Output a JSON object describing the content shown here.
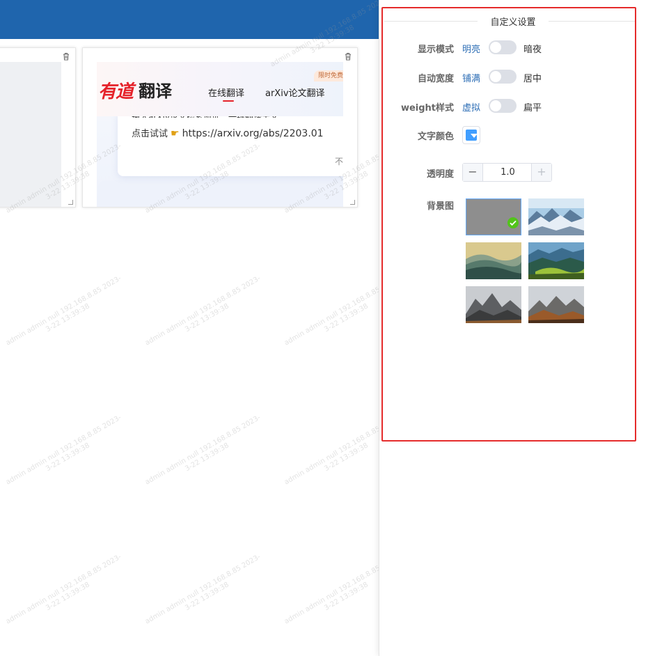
{
  "watermark": {
    "line1": "admin admin null 192.168.8.85 2023-",
    "line2": "3-22 13:39:38"
  },
  "youdao_card": {
    "logo_mark": "有道",
    "logo_name": "翻译",
    "tabs": [
      "在线翻译",
      "arXiv论文翻译"
    ],
    "badge": "限时免费",
    "text_line1": "输入arXiv论文检索地址，一键翻译全文",
    "try_label": "点击试试",
    "url": "https://arxiv.org/abs/2203.01",
    "more": "不"
  },
  "settings": {
    "title": "自定义设置",
    "display_mode": {
      "label": "显示模式",
      "left": "明亮",
      "right": "暗夜",
      "on": false
    },
    "auto_width": {
      "label": "自动宽度",
      "left": "铺满",
      "right": "居中",
      "on": false
    },
    "weight_style": {
      "label": "weight样式",
      "left": "虚拟",
      "right": "扁平",
      "on": false
    },
    "text_color": {
      "label": "文字颜色",
      "value": "#409eff"
    },
    "opacity": {
      "label": "透明度",
      "value": "1.0",
      "dec": "−",
      "inc": "+"
    },
    "background": {
      "label": "背景图",
      "selected_index": 0,
      "options": [
        "gray",
        "snow-mountains",
        "misty-hills",
        "green-valley",
        "rocky-peaks",
        "autumn-peaks"
      ]
    }
  },
  "colors": {
    "topbar": "#1f65ad",
    "accent": "#2f6fb6",
    "highlight": "#e52b2b",
    "check": "#52c41a"
  }
}
